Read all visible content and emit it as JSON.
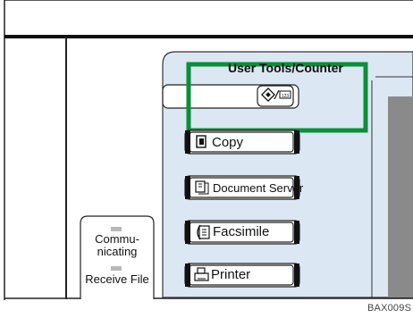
{
  "panel": {
    "title": "User Tools/Counter",
    "highlight_color": "#0a8f3a",
    "panel_color": "#dbe7f3"
  },
  "mode_keys": [
    {
      "label": "Copy",
      "icon": "copy-icon"
    },
    {
      "label": "Document Server",
      "icon": "document-server-icon"
    },
    {
      "label": "Facsimile",
      "icon": "facsimile-icon"
    },
    {
      "label": "Printer",
      "icon": "printer-icon"
    }
  ],
  "indicators": {
    "communicating": "Commu-\nnicating",
    "receive_file": "Receive File"
  },
  "figure_code": "BAX009S"
}
